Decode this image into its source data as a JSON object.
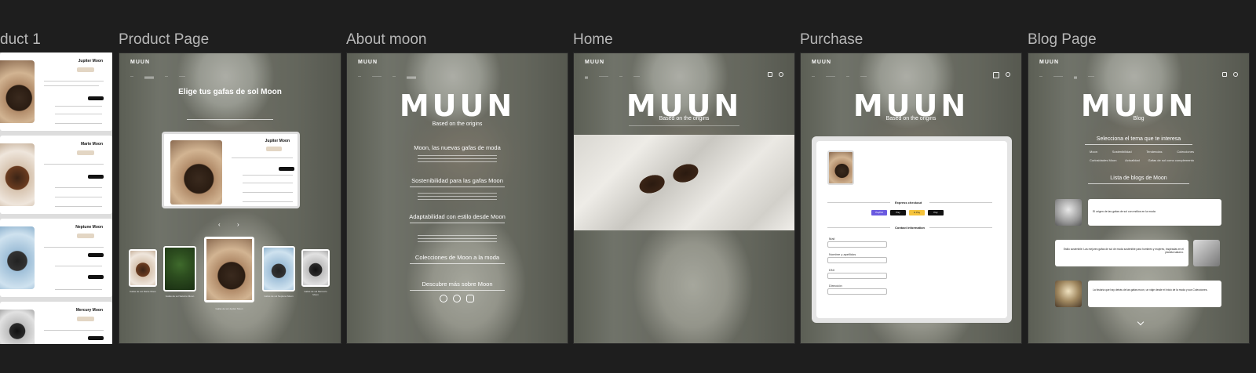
{
  "frames": {
    "product1": {
      "label": "duct 1"
    },
    "product_page": {
      "label": "Product Page"
    },
    "about": {
      "label": "About moon"
    },
    "home": {
      "label": "Home"
    },
    "purchase": {
      "label": "Purchase"
    },
    "blog": {
      "label": "Blog Page"
    }
  },
  "logo": "MUUN",
  "logo_small": "MUUN",
  "product1": {
    "items": [
      "Jupiter Moon",
      "Marte Moon",
      "Neptune Moon",
      "Mercury Moon"
    ]
  },
  "product_page": {
    "heading": "Elige tus gafas de sol Moon",
    "card_title": "Jupiter Moon",
    "carousel": [
      {
        "caption": "Gafas de sol Marte Moon"
      },
      {
        "caption": "Gafas de sol Saturno Moon"
      },
      {
        "caption": "Gafas de sol Jupiter Moon"
      },
      {
        "caption": "Gafas de sol Neptuno Moon"
      },
      {
        "caption": "Gafas de sol Mercurio Moon"
      }
    ]
  },
  "about": {
    "subtitle": "Based on the origins",
    "sections": [
      "Moon, las nuevas gafas de moda",
      "Sostenibilidad para las gafas Moon",
      "Adaptabilidad con estilo desde Moon",
      "Colecciones de Moon a la moda",
      "Descubre más sobre Moon"
    ]
  },
  "home": {
    "subtitle": "Based on the origins"
  },
  "purchase": {
    "subtitle": "Based on the origins",
    "express_checkout": "Express checkout",
    "pay_options": [
      "PayPal",
      "Pay",
      "G Pay",
      "Pay"
    ],
    "contact_information": "Contact information",
    "fields": [
      "Mail",
      "Nombre y apellidos",
      "DNI",
      "Dirección"
    ]
  },
  "blog": {
    "subtitle": "Blog",
    "choose_topic": "Selecciona el tema que te interesa",
    "topics_row1": [
      "Moon",
      "Sostenibilidad",
      "Tendencias",
      "Colecciones"
    ],
    "topics_row2": [
      "Curiosidades Moon",
      "Actualidad",
      "Gafas de sol como complemento"
    ],
    "list_title": "Lista de blogs de Moon",
    "posts": [
      "El origen de las gafas de sol con estilos en la moda",
      "Estilo sostenible: Las mejores gafas de sol de moda sostenible para hombres y mujeres, inspiradas en el planeta saturno.",
      "La historia que hay detrás de las gafas moon, un viaje desde el inicio de la moda y sus Colecciones."
    ]
  }
}
